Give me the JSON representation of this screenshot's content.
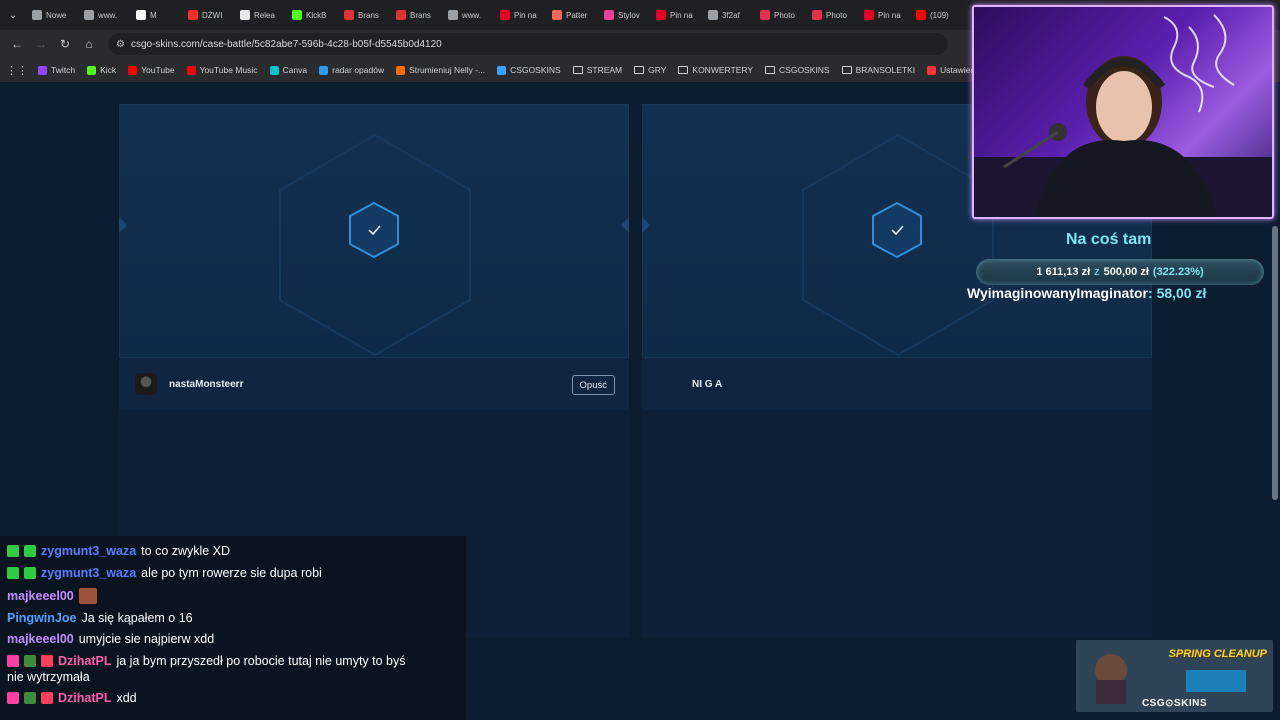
{
  "tabs": [
    {
      "label": "Nowe",
      "color": "#9aa0a6"
    },
    {
      "label": "www.",
      "color": "#9aa0a6"
    },
    {
      "label": "M",
      "color": "#ffffff"
    },
    {
      "label": "DŹWI",
      "color": "#ff2a2a"
    },
    {
      "label": "Relea",
      "color": "#e8e8e8"
    },
    {
      "label": "KickB",
      "color": "#53fc18"
    },
    {
      "label": "Brans",
      "color": "#d33"
    },
    {
      "label": "Brans",
      "color": "#d33"
    },
    {
      "label": "www.",
      "color": "#9aa0a6"
    },
    {
      "label": "Pin na",
      "color": "#e60023"
    },
    {
      "label": "Patter",
      "color": "#f96854"
    },
    {
      "label": "Stylov",
      "color": "#e84393"
    },
    {
      "label": "Pin na",
      "color": "#e60023"
    },
    {
      "label": "3f2af",
      "color": "#9aa0a6"
    },
    {
      "label": "Photo",
      "color": "#e0304d"
    },
    {
      "label": "Photo",
      "color": "#e0304d"
    },
    {
      "label": "Pin na",
      "color": "#e60023"
    },
    {
      "label": "(109)",
      "color": "#ff0000"
    }
  ],
  "nav": {
    "url": "csgo-skins.com/case-battle/5c82abe7-596b-4c28-b05f-d5545b0d4120"
  },
  "bookmarks": [
    {
      "label": "Twitch",
      "color": "#9146ff",
      "folder": false
    },
    {
      "label": "Kick",
      "color": "#53fc18",
      "folder": false
    },
    {
      "label": "YouTube",
      "color": "#ff0000",
      "folder": false
    },
    {
      "label": "YouTube Music",
      "color": "#ff0000",
      "folder": false
    },
    {
      "label": "Canva",
      "color": "#00c4cc",
      "folder": false
    },
    {
      "label": "radar opadów",
      "color": "#2b9af3",
      "folder": false
    },
    {
      "label": "Strumieniuj Nelly -...",
      "color": "#ff6a00",
      "folder": false
    },
    {
      "label": "CSGOSKINS",
      "color": "#3aa0ff",
      "folder": false
    },
    {
      "label": "STREAM",
      "color": "",
      "folder": true
    },
    {
      "label": "GRY",
      "color": "",
      "folder": true
    },
    {
      "label": "KONWERTERY",
      "color": "",
      "folder": true
    },
    {
      "label": "CSGOSKINS",
      "color": "",
      "folder": true
    },
    {
      "label": "BRANSOLETKI",
      "color": "",
      "folder": true
    },
    {
      "label": "Ustawienia strumien...",
      "color": "#ff3333",
      "folder": false
    }
  ],
  "battle": {
    "player1": {
      "name": "nastaMonsteerr",
      "leave_label": "Opuść"
    },
    "player2": {
      "name": "NI G A"
    },
    "accent": "#2f8fd9"
  },
  "overlay": {
    "goal_title": "Na coś tam",
    "goal_current": "1 611,13 zł",
    "goal_of": "z",
    "goal_target": "500,00 zł",
    "goal_percent": "(322.23%)",
    "donor_name": "WyimaginowanyImaginator",
    "donor_amount": "58,00 zł",
    "promo_title": "SPRING CLEANUP",
    "promo_brand": "CSG⊙SKINS"
  },
  "chat": [
    {
      "user": "zygmunt3_waza",
      "color": "#5a7cff",
      "message": "to co zwykle XD",
      "badges": [
        "#2ecc40",
        "#2ecc40"
      ]
    },
    {
      "user": "zygmunt3_waza",
      "color": "#5a7cff",
      "message": "ale po tym rowerze sie dupa robi",
      "badges": [
        "#2ecc40",
        "#2ecc40"
      ]
    },
    {
      "user": "majkeeel00",
      "color": "#c58cff",
      "message": "",
      "badges": [],
      "emote": true
    },
    {
      "user": "PingwinJoe",
      "color": "#4aa3ff",
      "message": "Ja się kąpałem o 16",
      "badges": []
    },
    {
      "user": "majkeeel00",
      "color": "#c58cff",
      "message": "umyjcie sie najpierw xdd",
      "badges": []
    },
    {
      "user": "DzihatPL",
      "color": "#ff5cae",
      "message": "ja ja bym przyszedł po robocie tutaj nie umyty to byś",
      "badges": [
        "#ff3fa4",
        "#3c8c3c",
        "#ff3f5a"
      ]
    },
    {
      "user": "",
      "color": "#ffffff",
      "message": "nie wytrzymała",
      "badges": []
    },
    {
      "user": "DzihatPL",
      "color": "#ff5cae",
      "message": "xdd",
      "badges": [
        "#ff3fa4",
        "#3c8c3c",
        "#ff3f5a"
      ]
    }
  ]
}
